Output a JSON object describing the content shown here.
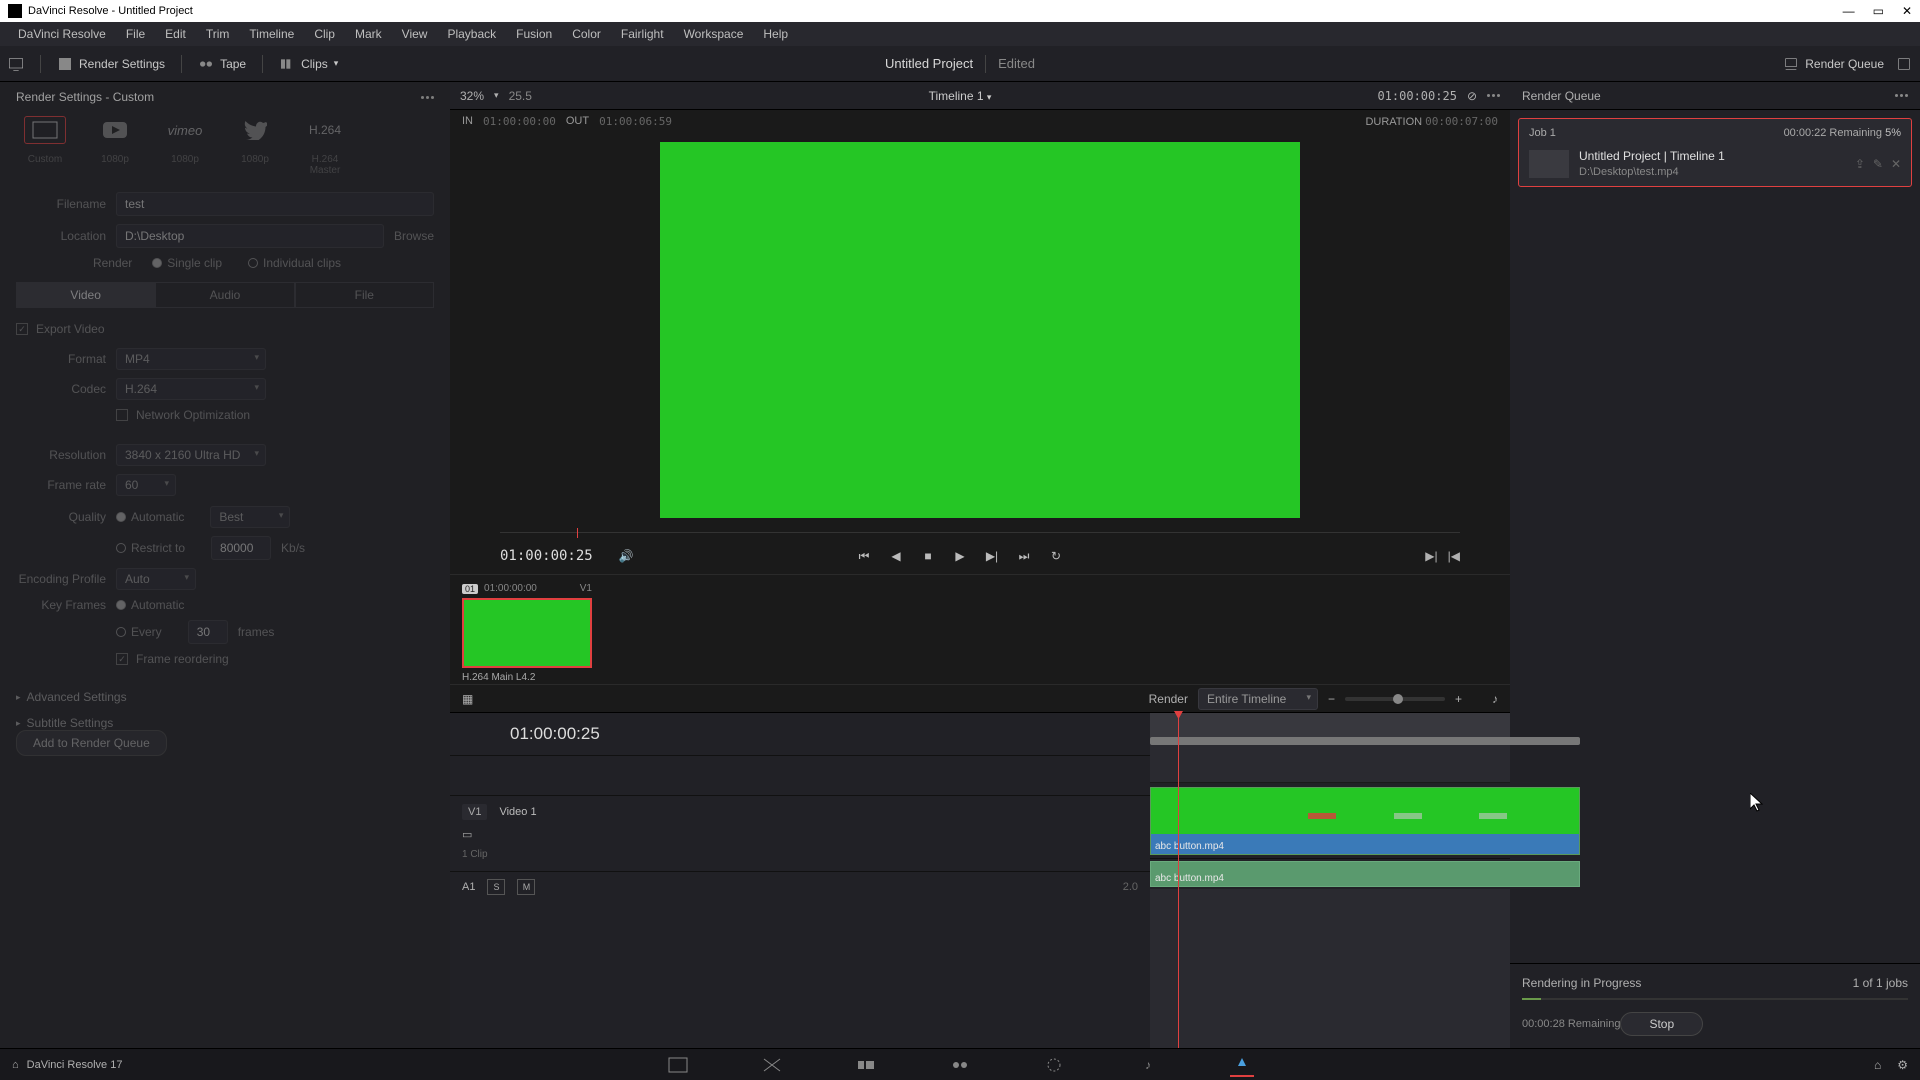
{
  "titlebar": {
    "text": "DaVinci Resolve - Untitled Project"
  },
  "menubar": [
    "DaVinci Resolve",
    "File",
    "Edit",
    "Trim",
    "Timeline",
    "Clip",
    "Mark",
    "View",
    "Playback",
    "Fusion",
    "Color",
    "Fairlight",
    "Workspace",
    "Help"
  ],
  "toolbar": {
    "render_settings": "Render Settings",
    "tape": "Tape",
    "clips": "Clips",
    "project": "Untitled Project",
    "edited": "Edited",
    "render_queue": "Render Queue"
  },
  "left": {
    "header": "Render Settings - Custom",
    "presets": [
      "Custom",
      "YouTube",
      "Vimeo",
      "Twitter",
      "H.264"
    ],
    "preset_sub": [
      "Custom",
      "1080p",
      "1080p",
      "1080p",
      "H.264 Master"
    ],
    "filename_label": "Filename",
    "filename_value": "test",
    "location_label": "Location",
    "location_value": "D:\\Desktop",
    "browse": "Browse",
    "render_label": "Render",
    "single_clip": "Single clip",
    "individual_clips": "Individual clips",
    "tabs": [
      "Video",
      "Audio",
      "File"
    ],
    "export_video": "Export Video",
    "format_label": "Format",
    "format_value": "MP4",
    "codec_label": "Codec",
    "codec_value": "H.264",
    "network_opt": "Network Optimization",
    "resolution_label": "Resolution",
    "resolution_value": "3840 x 2160 Ultra HD",
    "framerate_label": "Frame rate",
    "framerate_value": "60",
    "quality_label": "Quality",
    "quality_auto": "Automatic",
    "quality_best": "Best",
    "restrict_to": "Restrict to",
    "restrict_val": "80000",
    "kbs": "Kb/s",
    "enc_profile_label": "Encoding Profile",
    "enc_profile_value": "Auto",
    "keyframes_label": "Key Frames",
    "kf_auto": "Automatic",
    "kf_every": "Every",
    "kf_val": "30",
    "kf_frames": "frames",
    "frame_reorder": "Frame reordering",
    "advanced": "Advanced Settings",
    "subtitle": "Subtitle Settings",
    "add_queue": "Add to Render Queue"
  },
  "viewer": {
    "zoom": "32%",
    "fps": "25.5",
    "timeline_name": "Timeline 1",
    "timecode": "01:00:00:25",
    "in_label": "IN",
    "in_tc": "01:00:00:00",
    "out_label": "OUT",
    "out_tc": "01:00:06:59",
    "dur_label": "DURATION",
    "dur_tc": "00:00:07:00",
    "transport_tc": "01:00:00:25",
    "thumb_badge": "01",
    "thumb_tc": "01:00:00:00",
    "thumb_track": "V1",
    "thumb_name": "H.264 Main L4.2"
  },
  "tltools": {
    "render": "Render",
    "range": "Entire Timeline"
  },
  "timeline": {
    "tc": "01:00:00:25",
    "v1": "V1",
    "v1name": "Video 1",
    "v1sub": "1 Clip",
    "a1": "A1",
    "a1ch": "2.0",
    "clip_name": "abc button.mp4"
  },
  "right": {
    "header": "Render Queue",
    "job_name": "Job 1",
    "job_remaining": "00:00:22 Remaining",
    "job_pct": "5%",
    "job_title": "Untitled Project | Timeline 1",
    "job_path": "D:\\Desktop\\test.mp4",
    "status_title": "Rendering in Progress",
    "status_count": "1 of 1 jobs",
    "status_remaining": "00:00:28 Remaining",
    "stop": "Stop"
  },
  "pagebar": {
    "app": "DaVinci Resolve 17"
  }
}
